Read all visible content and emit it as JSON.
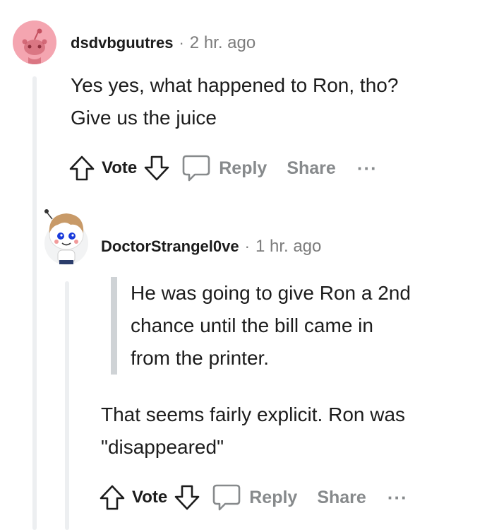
{
  "comments": [
    {
      "username": "dsdvbguutres",
      "separator": "·",
      "time": "2 hr. ago",
      "body": [
        "Yes yes, what happened to Ron, tho?",
        "Give us the juice"
      ],
      "vote_label": "Vote",
      "reply_label": "Reply",
      "share_label": "Share",
      "more_label": "···",
      "avatar_color": "#f4a5b0"
    },
    {
      "username": "DoctorStrangel0ve",
      "separator": "·",
      "time": "1 hr. ago",
      "quote": [
        "He was going to give Ron a 2nd",
        "chance until the bill came in",
        "from the printer."
      ],
      "body": [
        "That seems fairly explicit. Ron was",
        "\"disappeared\""
      ],
      "vote_label": "Vote",
      "reply_label": "Reply",
      "share_label": "Share",
      "more_label": "···"
    }
  ],
  "colors": {
    "text": "#1c1c1c",
    "meta": "#7c7c7c",
    "action_gray": "#878a8c",
    "thread_line": "#edeff1",
    "quote_bar": "#cfd3d6"
  },
  "icons": [
    "upvote-arrow-icon",
    "downvote-arrow-icon",
    "comment-bubble-icon",
    "more-dots-icon"
  ]
}
